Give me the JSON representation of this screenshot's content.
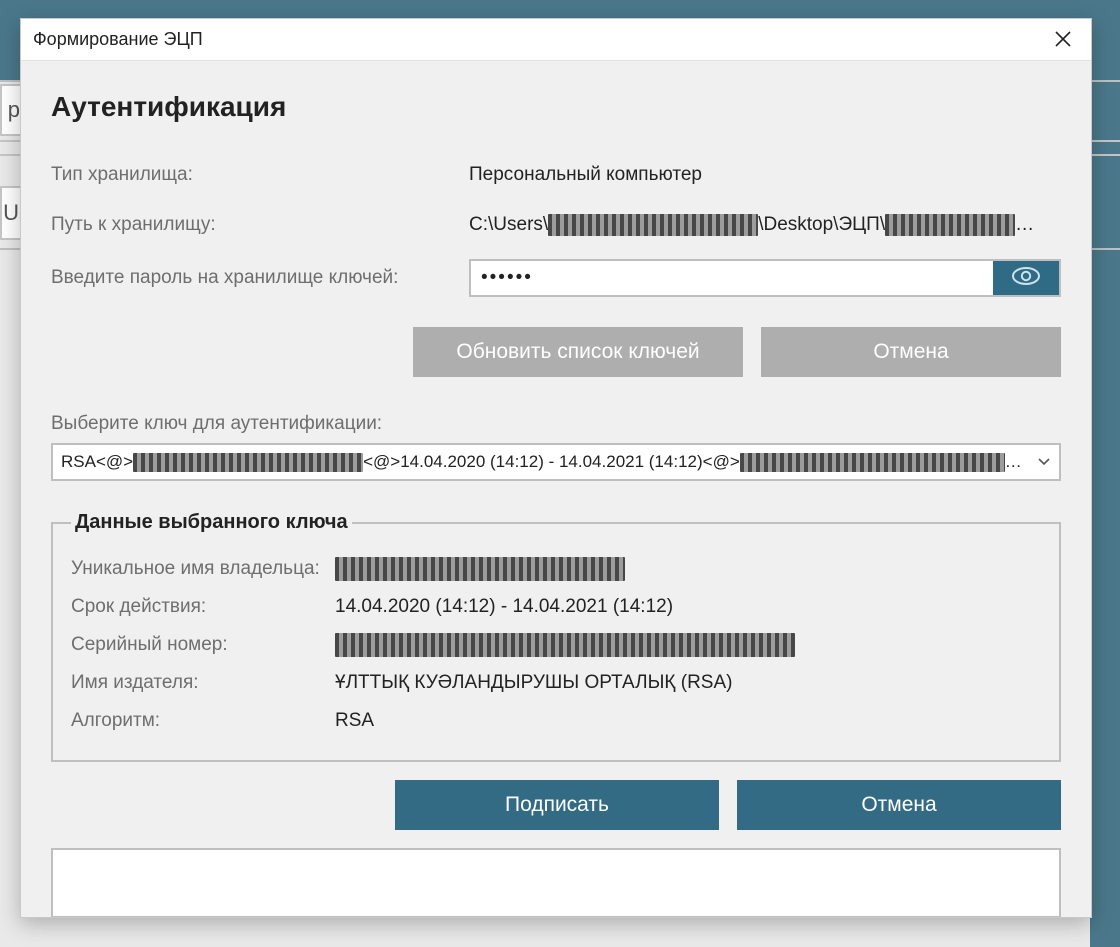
{
  "background": {
    "left_input1_text": "р",
    "left_input2_text": "Us"
  },
  "modal": {
    "window_title": "Формирование ЭЦП",
    "page_title": "Аутентификация",
    "storage_type_label": "Тип хранилища:",
    "storage_type_value": "Персональный компьютер",
    "storage_path_label": "Путь к хранилищу:",
    "storage_path_prefix": "C:\\Users\\",
    "storage_path_mid": "\\Desktop\\ЭЦП\\",
    "storage_path_ellipsis": "…",
    "password_label": "Введите пароль на хранилище ключей:",
    "password_value": "••••••",
    "refresh_keys_label": "Обновить список ключей",
    "cancel_label": "Отмена",
    "select_key_label": "Выберите ключ для аутентификации:",
    "select_key_prefix": "RSA<@>",
    "select_key_mid": "<@>14.04.2020 (14:12) - 14.04.2021 (14:12)<@>",
    "select_key_suffix": "…",
    "key_data": {
      "legend": "Данные выбранного ключа",
      "owner_label": "Уникальное имя владельца:",
      "validity_label": "Срок действия:",
      "validity_value": "14.04.2020 (14:12) - 14.04.2021 (14:12)",
      "serial_label": "Серийный номер:",
      "issuer_label": "Имя издателя:",
      "issuer_value": "ҰЛТТЫҚ КУӘЛАНДЫРУШЫ ОРТАЛЫҚ (RSA)",
      "algo_label": "Алгоритм:",
      "algo_value": "RSA"
    },
    "sign_label": "Подписать",
    "cancel2_label": "Отмена"
  }
}
